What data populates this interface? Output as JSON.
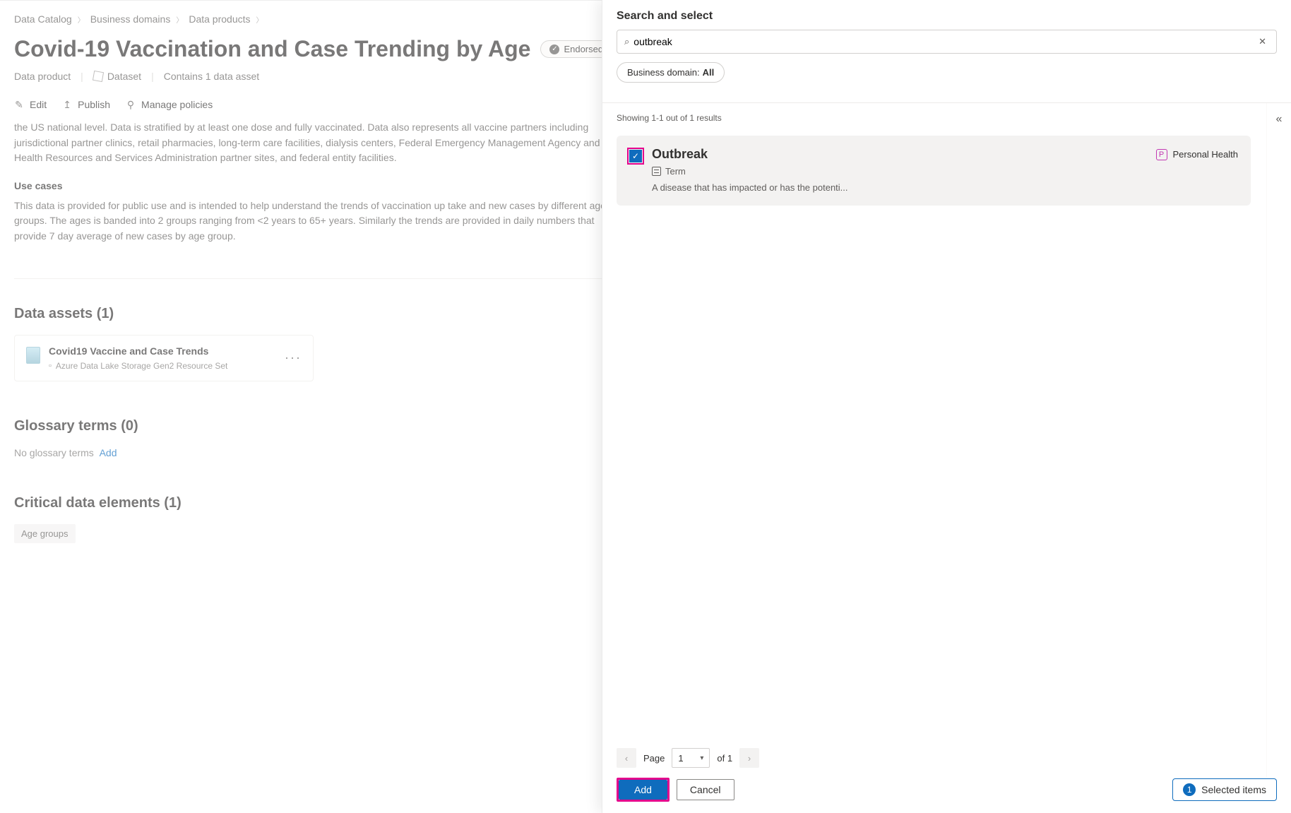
{
  "breadcrumb": {
    "a": "Data Catalog",
    "b": "Business domains",
    "c": "Data products"
  },
  "page": {
    "title": "Covid-19 Vaccination and Case Trending by Age",
    "endorsed": "Endorsed",
    "meta_product": "Data product",
    "meta_dataset": "Dataset",
    "meta_assets": "Contains 1 data asset"
  },
  "actions": {
    "edit": "Edit",
    "publish": "Publish",
    "manage": "Manage policies"
  },
  "desc": {
    "p1": "the US national level. Data is stratified by at least one dose and fully vaccinated. Data also represents all vaccine partners including jurisdictional partner clinics, retail pharmacies, long-term care facilities, dialysis centers, Federal Emergency Management Agency and Health Resources and Services Administration partner sites, and federal entity facilities.",
    "uc_h": "Use cases",
    "uc_p": "This data is provided for public use and is intended to help understand the trends of vaccination up take and new cases by different age groups.  The ages is banded into 2 groups ranging from <2 years to 65+ years.  Similarly the trends are provided in daily numbers that provide 7 day average of new cases by age group."
  },
  "assets": {
    "heading": "Data assets (1)",
    "title": "Covid19 Vaccine and Case Trends",
    "sub": "Azure Data Lake Storage Gen2 Resource Set"
  },
  "glossary": {
    "heading": "Glossary terms (0)",
    "empty": "No glossary terms",
    "add": "Add"
  },
  "cde": {
    "heading": "Critical data elements (1)",
    "chip": "Age groups"
  },
  "panel": {
    "title": "Search and select",
    "search_value": "outbreak",
    "filter_label": "Business domain:",
    "filter_value": "All",
    "results_text": "Showing 1-1 out of 1 results",
    "result": {
      "title": "Outbreak",
      "type": "Term",
      "tag": "Personal Health",
      "tag_letter": "P",
      "desc": "A disease that has impacted or has the potenti..."
    },
    "pager": {
      "page_label": "Page",
      "page": "1",
      "of_label": "of 1"
    },
    "add_btn": "Add",
    "cancel_btn": "Cancel",
    "selected_count": "1",
    "selected_label": "Selected items"
  }
}
